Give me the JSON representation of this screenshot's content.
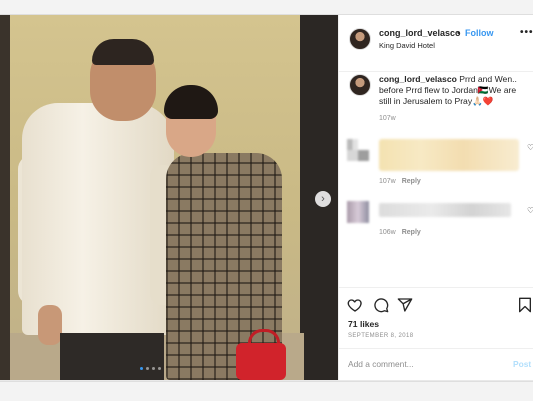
{
  "header": {
    "username": "cong_lord_velasco",
    "separator": "•",
    "follow_label": "Follow",
    "location": "King David Hotel",
    "more_label": "•••"
  },
  "caption": {
    "username": "cong_lord_velasco",
    "text": "Prrd and Wen.. before Prrd flew to Jordan🇯🇴We are still in Jerusalem to Pray🙏🏻❤️",
    "time": "107w"
  },
  "comments": [
    {
      "time": "107w",
      "reply_label": "Reply",
      "text_blurred": true
    },
    {
      "time": "106w",
      "reply_label": "Reply",
      "text_blurred": true
    }
  ],
  "media": {
    "next_icon": "chevron-right-icon",
    "next_glyph": "›",
    "carousel_pages": 4,
    "carousel_active": 1
  },
  "actions": {
    "likes": "71 likes",
    "date": "SEPTEMBER 8, 2018"
  },
  "add_comment": {
    "placeholder": "Add a comment...",
    "post_label": "Post"
  },
  "colors": {
    "link": "#3897f0",
    "muted": "#8e8e8e",
    "post_disabled": "#b2dffc",
    "bag_red": "#d1232b"
  }
}
